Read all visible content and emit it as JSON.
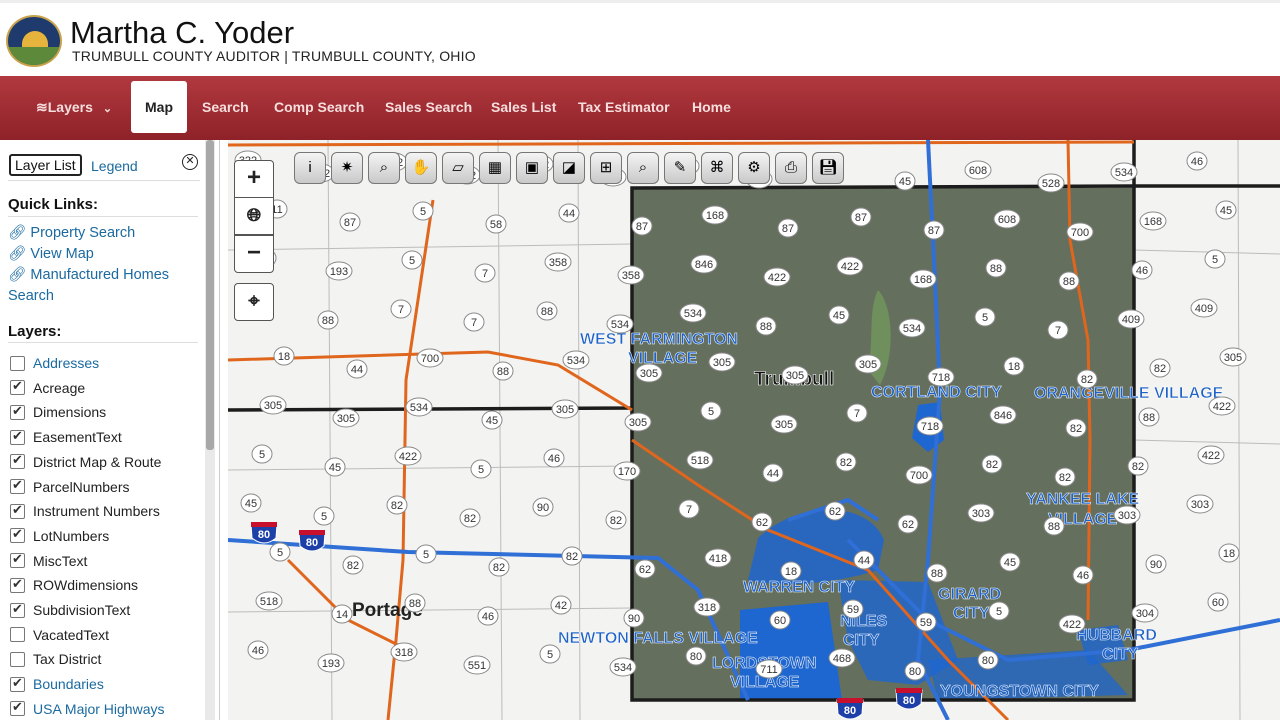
{
  "header": {
    "title": "Martha C. Yoder",
    "subtitle": "TRUMBULL COUNTY AUDITOR | TRUMBULL COUNTY, OHIO"
  },
  "nav": {
    "layers": "Layers",
    "map": "Map",
    "search": "Search",
    "comp_search": "Comp Search",
    "sales_search": "Sales Search",
    "sales_list": "Sales List",
    "tax_estimator": "Tax Estimator",
    "home": "Home"
  },
  "sidebar": {
    "tab_layer_list": "Layer List",
    "tab_legend": "Legend",
    "quick_links_heading": "Quick Links:",
    "quick_links": [
      "Property Search",
      "View Map",
      "Manufactured Homes"
    ],
    "quick_links_cont": "Search",
    "layers_heading": "Layers:",
    "layers": [
      {
        "label": "Addresses",
        "checked": false,
        "link": true
      },
      {
        "label": "Acreage",
        "checked": true,
        "link": false
      },
      {
        "label": "Dimensions",
        "checked": true,
        "link": false
      },
      {
        "label": "EasementText",
        "checked": true,
        "link": false
      },
      {
        "label": "District Map & Route",
        "checked": true,
        "link": false
      },
      {
        "label": "ParcelNumbers",
        "checked": true,
        "link": false
      },
      {
        "label": "Instrument Numbers",
        "checked": true,
        "link": false
      },
      {
        "label": "LotNumbers",
        "checked": true,
        "link": false
      },
      {
        "label": "MiscText",
        "checked": true,
        "link": false
      },
      {
        "label": "ROWdimensions",
        "checked": true,
        "link": false
      },
      {
        "label": "SubdivisionText",
        "checked": true,
        "link": false
      },
      {
        "label": "VacatedText",
        "checked": false,
        "link": false
      },
      {
        "label": "Tax District",
        "checked": false,
        "link": false
      },
      {
        "label": "Boundaries",
        "checked": true,
        "link": true
      },
      {
        "label": "USA Major Highways",
        "checked": true,
        "link": true
      }
    ]
  },
  "map": {
    "zoom_in": "+",
    "zoom_out": "−",
    "counties": [
      "Trumbull",
      "Portage"
    ],
    "places": [
      "WEST FARMINGTON",
      "VILLAGE",
      "CORTLAND CITY",
      "ORANGEVILLE VILLAGE",
      "YANKEE LAKE",
      "VILLAGE",
      "WARREN CITY",
      "GIRARD",
      "CITY",
      "NILES",
      "CITY",
      "NEWTON FALLS VILLAGE",
      "LORDSTOWN",
      "VILLAGE",
      "HUBBARD",
      "CITY",
      "YOUNGSTOWN CITY"
    ],
    "road_labels": [
      "322",
      "322",
      "322",
      "322",
      "322",
      "322",
      "322",
      "322",
      "7",
      "45",
      "608",
      "528",
      "534",
      "46",
      "11",
      "87",
      "5",
      "58",
      "44",
      "87",
      "168",
      "87",
      "87",
      "87",
      "608",
      "700",
      "168",
      "45",
      "46",
      "193",
      "5",
      "7",
      "358",
      "358",
      "846",
      "422",
      "422",
      "168",
      "88",
      "88",
      "46",
      "5",
      "88",
      "88",
      "7",
      "7",
      "88",
      "534",
      "534",
      "88",
      "45",
      "534",
      "5",
      "7",
      "409",
      "409",
      "18",
      "44",
      "700",
      "88",
      "534",
      "305",
      "305",
      "305",
      "305",
      "718",
      "18",
      "82",
      "82",
      "305",
      "305",
      "305",
      "534",
      "45",
      "305",
      "305",
      "5",
      "305",
      "7",
      "718",
      "846",
      "82",
      "88",
      "422",
      "5",
      "45",
      "422",
      "5",
      "46",
      "170",
      "518",
      "44",
      "82",
      "700",
      "82",
      "82",
      "82",
      "422",
      "45",
      "5",
      "82",
      "82",
      "90",
      "82",
      "7",
      "62",
      "62",
      "62",
      "303",
      "88",
      "303",
      "303",
      "5",
      "82",
      "5",
      "82",
      "82",
      "62",
      "418",
      "18",
      "44",
      "88",
      "45",
      "46",
      "90",
      "18",
      "518",
      "14",
      "88",
      "46",
      "42",
      "90",
      "318",
      "60",
      "59",
      "59",
      "5",
      "422",
      "304",
      "60",
      "46",
      "193",
      "318",
      "551",
      "5",
      "534",
      "80",
      "711",
      "468",
      "80",
      "80"
    ],
    "highway_shields": [
      "80",
      "80",
      "80",
      "80"
    ],
    "colors": {
      "county_line": "#222222",
      "road": "#e0661d",
      "highway": "#2f6fd6",
      "city_fill": "#1e66d0"
    }
  },
  "toolbar": {
    "tools": [
      "info-icon",
      "identify-icon",
      "zoom-area-icon",
      "pan-hand-icon",
      "eraser-icon",
      "select-parcel-icon",
      "photo-icon",
      "map-layers-icon",
      "measure-icon",
      "magnifier-icon",
      "pencil-icon",
      "buffer-icon",
      "share-icon",
      "print-icon",
      "save-icon"
    ]
  }
}
